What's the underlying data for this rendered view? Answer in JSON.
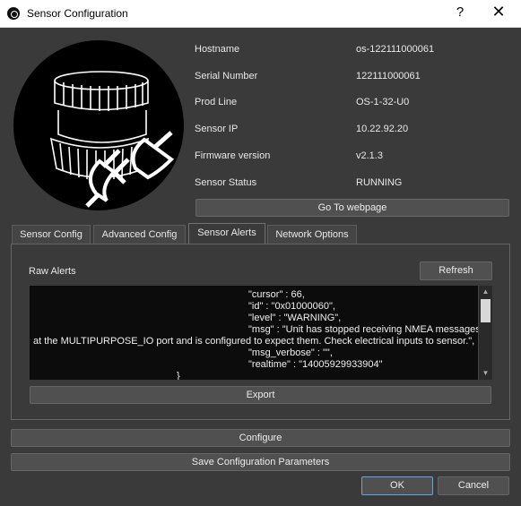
{
  "window": {
    "title": "Sensor Configuration",
    "help_glyph": "?",
    "close_glyph": "✕"
  },
  "sensor_info": {
    "rows": [
      {
        "label": "Hostname",
        "value": "os-122111000061"
      },
      {
        "label": "Serial Number",
        "value": "122111000061"
      },
      {
        "label": "Prod Line",
        "value": "OS-1-32-U0"
      },
      {
        "label": "Sensor IP",
        "value": "10.22.92.20"
      },
      {
        "label": "Firmware version",
        "value": "v2.1.3"
      },
      {
        "label": "Sensor Status",
        "value": "RUNNING"
      }
    ]
  },
  "buttons": {
    "go_to_webpage": "Go To webpage",
    "refresh": "Refresh",
    "export": "Export",
    "configure": "Configure",
    "save_config": "Save Configuration Parameters",
    "ok": "OK",
    "cancel": "Cancel"
  },
  "tabs": [
    {
      "label": "Sensor Config",
      "active": false
    },
    {
      "label": "Advanced Config",
      "active": false
    },
    {
      "label": "Sensor Alerts",
      "active": true
    },
    {
      "label": "Network Options",
      "active": false
    }
  ],
  "alerts": {
    "heading": "Raw Alerts",
    "lines": [
      "\"cursor\" : 66,",
      "\"id\" : \"0x01000060\",",
      "\"level\" : \"WARNING\",",
      "\"msg\" : \"Unit has stopped receiving NMEA messages",
      "at the MULTIPURPOSE_IO port and is configured to expect them. Check electrical inputs to sensor.\",",
      "\"msg_verbose\" : \"\",",
      "\"realtime\" : \"14005929933904\"",
      "}"
    ]
  },
  "colors": {
    "window_bg": "#3a3a3a",
    "text_area_bg": "#0c0c0c",
    "default_button_border": "#7aa0c8"
  },
  "icons": [
    "app-icon",
    "help-icon",
    "close-icon",
    "sensor-plug-logo",
    "scroll-up-icon",
    "scroll-down-icon"
  ]
}
